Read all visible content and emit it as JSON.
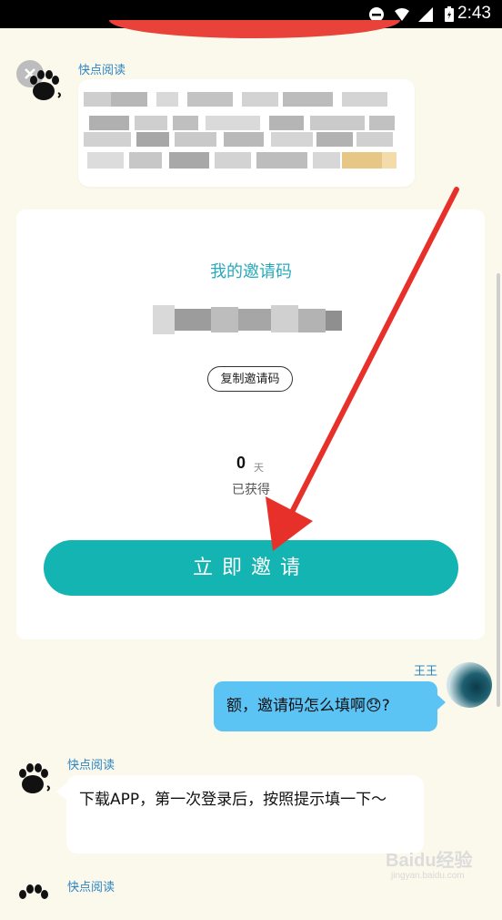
{
  "status_bar": {
    "time": "2:43"
  },
  "messages": {
    "bot_name": "快点阅读",
    "user_name": "王王",
    "user_message": "额，邀请码怎么填啊",
    "user_message_emoji": "😞",
    "user_message_tail": "?",
    "reply_text": "下载APP，第一次登录后，按照提示填一下～"
  },
  "invite_card": {
    "title": "我的邀请码",
    "copy_button": "复制邀请码",
    "days_count": "0",
    "days_unit": "天",
    "obtained_label": "已获得",
    "invite_button": "立即邀请"
  },
  "watermark": {
    "brand": "Baidu经验",
    "url": "jingyan.baidu.com"
  },
  "colors": {
    "accent": "#14b4b2",
    "user_bubble": "#5cc3f5",
    "name_blue": "#2b85c4",
    "arrow_red": "#e8302a"
  }
}
